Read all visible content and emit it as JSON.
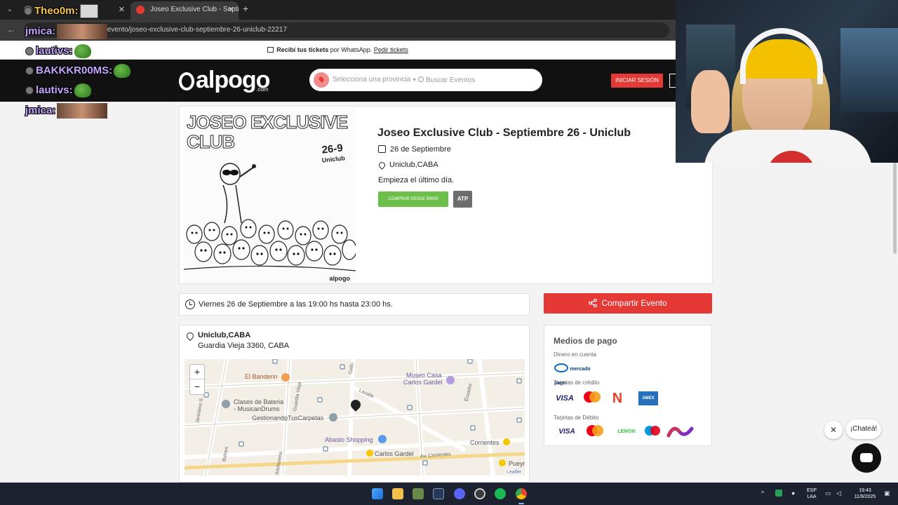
{
  "browser": {
    "tabs": [
      {
        "label": "Theo0m:"
      },
      {
        "label": "Joseo Exclusive Club - Septiemb",
        "close": "✕"
      }
    ],
    "new_tab": "+",
    "url": "/evento/joseo-exclusive-club-septiembre-26-uniclub-22217",
    "tab_menu": "⌄",
    "back": "←"
  },
  "chat_overlay": [
    {
      "user": "jmica:",
      "color": "#c6a5ff"
    },
    {
      "user": "lautivs:",
      "color": "#c6a5ff"
    },
    {
      "user": "BAKKKR00MS:",
      "color": "#c6a5ff"
    },
    {
      "user": "lautivs:",
      "color": "#c6a5ff"
    },
    {
      "user": "jmica:",
      "color": "#c6a5ff"
    }
  ],
  "topnote": {
    "bold": "Recibí tus tickets",
    "text": " por WhatsApp. ",
    "link": "Pedir tickets"
  },
  "header": {
    "logo": "alpogo",
    "logo_suffix": ".com",
    "province_placeholder": "Selecciona una provincia",
    "search_placeholder": "Buscar Eventos",
    "login": "INICIAR SESIÓN"
  },
  "event": {
    "poster": {
      "title": "JOSEO EXCLUSIVE CLUB",
      "date": "26-9",
      "venue": "Uniclub",
      "brand": "alpogo"
    },
    "title": "Joseo Exclusive Club - Septiembre 26 - Uniclub",
    "date": "26 de Septiembre",
    "location": "Uniclub,CABA",
    "description": "Empieza el último día.",
    "buy_label": "COMPRAR DESDE $9000",
    "age_badge": "ATP"
  },
  "datetime": "Viernes 26 de Septiembre a las 19:00 hs hasta 23:00 hs.",
  "share": "Compartir Evento",
  "venue": {
    "name": "Uniclub,CABA",
    "address": "Guardia Vieja 3360, CABA",
    "map": {
      "zoom_in": "+",
      "zoom_out": "−",
      "labels": [
        "El Banderin",
        "Museo Casa",
        "Carlos Gardel",
        "Clases de Bateria",
        "- MusicanDrums",
        "GestionandoTusCarpetas",
        "Abasto Shopping",
        "Carlos Gardel",
        "Corrientes",
        "Pueyr"
      ],
      "streets": [
        "Gallo",
        "Lavalle",
        "Ecuador",
        "Jerónimo S",
        "Bulnes",
        "Anchorena",
        "Av. Corrientes",
        "Guardia Vieja"
      ],
      "attribution": "Leaflet"
    }
  },
  "payment": {
    "title": "Medios de pago",
    "account_label": "Dinero en cuenta",
    "account_logo": "mercado pago",
    "credit_label": "Tarjetas de crédito",
    "credit_logos": [
      "VISA",
      "mastercard",
      "N",
      "AMEX"
    ],
    "debit_label": "Tarjetas de Débito",
    "debit_logos": [
      "VISA",
      "mastercard",
      "LEMON",
      "maestro",
      "∿"
    ]
  },
  "chat_widget": {
    "close": "✕",
    "bubble": "¡Chateá!"
  },
  "taskbar": {
    "lang": "ESP",
    "lang2": "LAA",
    "time": "19:43",
    "date": "11/9/2025"
  }
}
